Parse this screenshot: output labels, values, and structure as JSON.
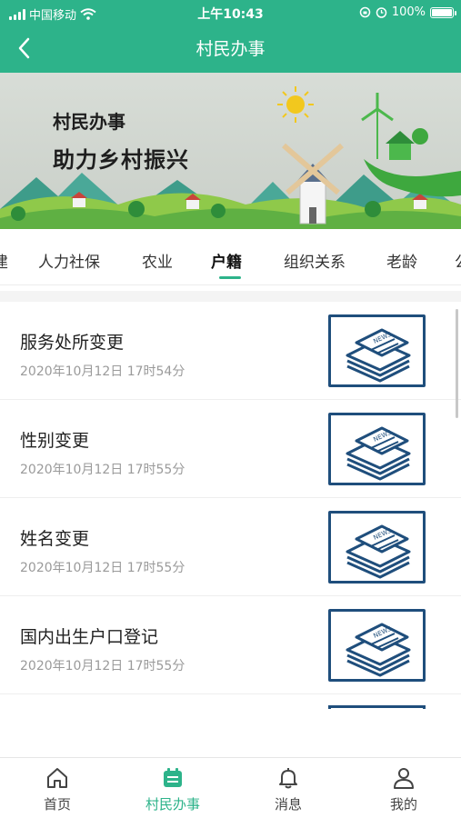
{
  "status_bar": {
    "carrier": "中国移动",
    "time": "上午10:43",
    "battery": "100%"
  },
  "navbar": {
    "title": "村民办事",
    "back_icon": "chevron-left-icon"
  },
  "banner": {
    "line1": "村民办事",
    "line2": "助力乡村振兴"
  },
  "tabs": [
    {
      "label": "建"
    },
    {
      "label": "人力社保"
    },
    {
      "label": "农业"
    },
    {
      "label": "户籍",
      "active": true
    },
    {
      "label": "组织关系"
    },
    {
      "label": "老龄"
    },
    {
      "label": "公"
    }
  ],
  "list": [
    {
      "title": "服务处所变更",
      "time": "2020年10月12日 17时54分"
    },
    {
      "title": "性别变更",
      "time": "2020年10月12日 17时55分"
    },
    {
      "title": "姓名变更",
      "time": "2020年10月12日 17时55分"
    },
    {
      "title": "国内出生户口登记",
      "time": "2020年10月12日 17时55分"
    }
  ],
  "tabbar": [
    {
      "label": "首页",
      "icon": "home-icon"
    },
    {
      "label": "村民办事",
      "icon": "calendar-icon",
      "active": true
    },
    {
      "label": "消息",
      "icon": "bell-icon"
    },
    {
      "label": "我的",
      "icon": "user-icon"
    }
  ],
  "colors": {
    "accent": "#2db38a",
    "thumb_border": "#1f4e7c"
  }
}
